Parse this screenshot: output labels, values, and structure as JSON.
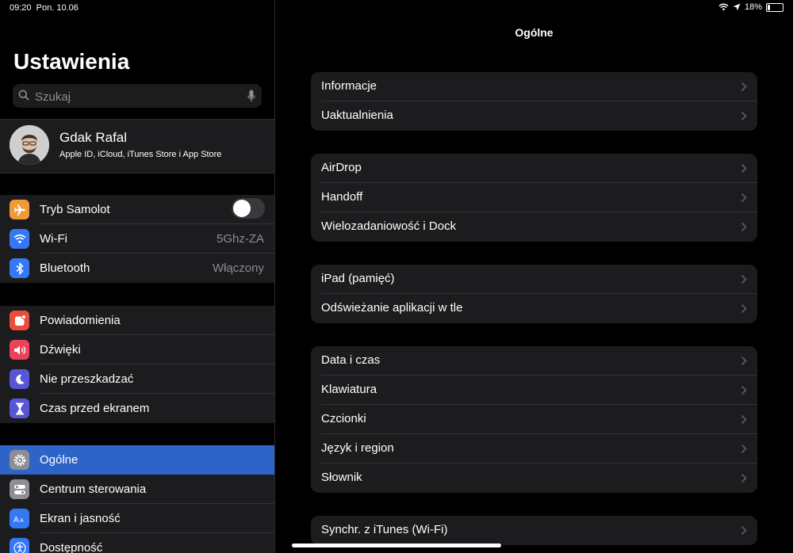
{
  "status": {
    "time": "09:20",
    "date": "Pon. 10.06",
    "battery_text": "18%",
    "battery_level": 0.18
  },
  "sidebar": {
    "title": "Ustawienia",
    "search": {
      "placeholder": "Szukaj"
    },
    "profile": {
      "name": "Gdak Rafal",
      "subtitle": "Apple ID, iCloud, iTunes Store i App Store"
    },
    "group1": [
      {
        "label": "Tryb Samolot",
        "icon": "airplane-icon",
        "color": "#f09a37",
        "toggle": false
      },
      {
        "label": "Wi-Fi",
        "icon": "wifi-icon",
        "color": "#3478f6",
        "value": "5Ghz-ZA"
      },
      {
        "label": "Bluetooth",
        "icon": "bluetooth-icon",
        "color": "#3478f6",
        "value": "Włączony"
      }
    ],
    "group2": [
      {
        "label": "Powiadomienia",
        "icon": "notifications-icon",
        "color": "#eb4d3d"
      },
      {
        "label": "Dźwięki",
        "icon": "sounds-icon",
        "color": "#eb445a"
      },
      {
        "label": "Nie przeszkadzać",
        "icon": "moon-icon",
        "color": "#5856d6"
      },
      {
        "label": "Czas przed ekranem",
        "icon": "hourglass-icon",
        "color": "#5856d6"
      }
    ],
    "group3": [
      {
        "label": "Ogólne",
        "icon": "gear-icon",
        "color": "#8e8e93",
        "selected": true
      },
      {
        "label": "Centrum sterowania",
        "icon": "toggles-icon",
        "color": "#8e8e93"
      },
      {
        "label": "Ekran i jasność",
        "icon": "display-icon",
        "color": "#3478f6"
      },
      {
        "label": "Dostępność",
        "icon": "accessibility-icon",
        "color": "#3478f6"
      }
    ]
  },
  "detail": {
    "title": "Ogólne",
    "groups": [
      [
        "Informacje",
        "Uaktualnienia"
      ],
      [
        "AirDrop",
        "Handoff",
        "Wielozadaniowość i Dock"
      ],
      [
        "iPad (pamięć)",
        "Odświeżanie aplikacji w tle"
      ],
      [
        "Data i czas",
        "Klawiatura",
        "Czcionki",
        "Język i region",
        "Słownik"
      ],
      [
        "Synchr. z iTunes (Wi-Fi)"
      ]
    ]
  }
}
